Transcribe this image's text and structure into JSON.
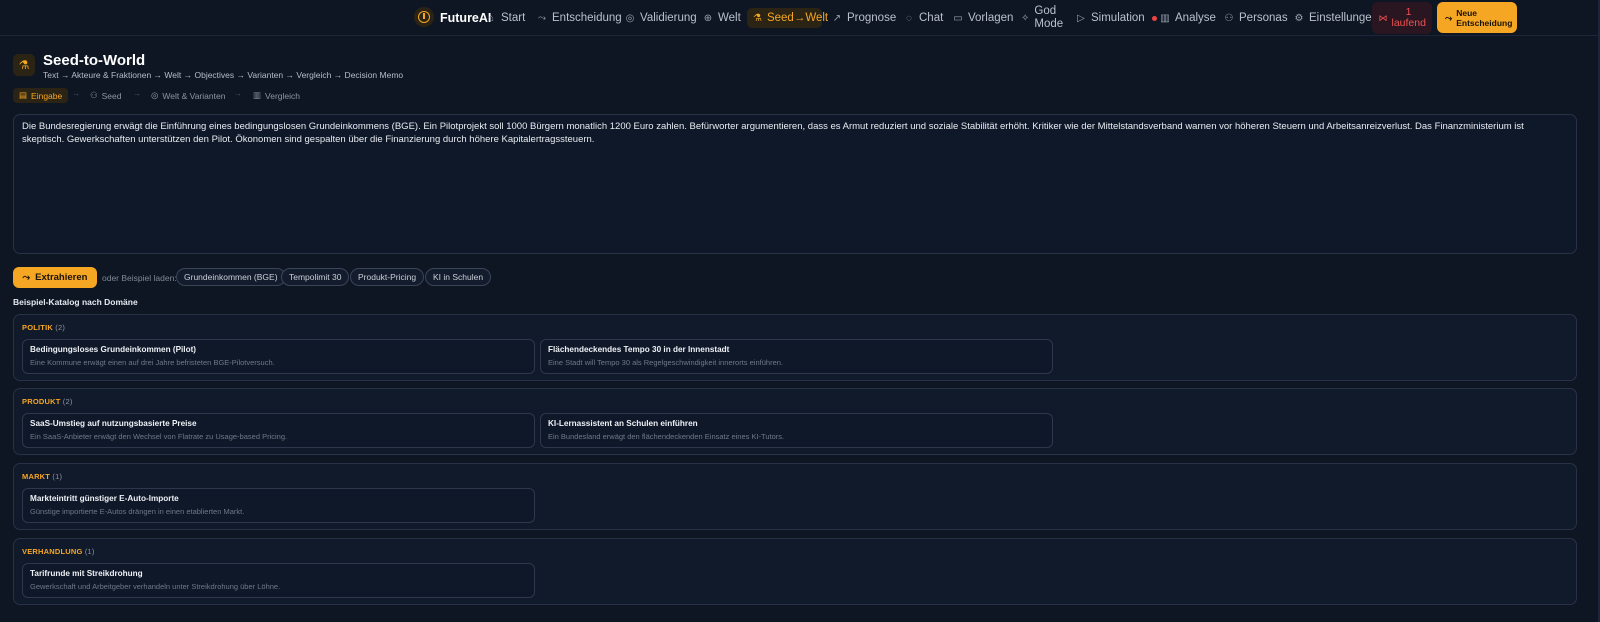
{
  "app": {
    "name": "FutureAI"
  },
  "nav": {
    "items": [
      {
        "label": "Start",
        "icon": "home-icon"
      },
      {
        "label": "Entscheidung",
        "icon": "route-icon"
      },
      {
        "label": "Validierung",
        "icon": "target-icon"
      },
      {
        "label": "Welt",
        "icon": "globe-icon"
      },
      {
        "label": "Seed→Welt",
        "icon": "flask-icon"
      },
      {
        "label": "Prognose",
        "icon": "trend-icon"
      },
      {
        "label": "Chat",
        "icon": "chat-icon"
      },
      {
        "label": "Vorlagen",
        "icon": "template-icon"
      },
      {
        "label": "God Mode",
        "icon": "sparkle-icon"
      },
      {
        "label": "Simulation",
        "icon": "play-icon"
      },
      {
        "label": "Analyse",
        "icon": "bar-chart-icon"
      },
      {
        "label": "Personas",
        "icon": "users-icon"
      },
      {
        "label": "Einstellungen",
        "icon": "gear-icon"
      }
    ],
    "running": "1 laufend",
    "new_decision": "Neue Entscheidung"
  },
  "page": {
    "title": "Seed-to-World",
    "subtitle": "Text → Akteure & Fraktionen → Welt → Objectives → Varianten → Vergleich → Decision Memo"
  },
  "steps": [
    "Eingabe",
    "Seed",
    "Welt & Varianten",
    "Vergleich"
  ],
  "input": {
    "value": "Die Bundesregierung erwägt die Einführung eines bedingungslosen Grundeinkommens (BGE). Ein Pilotprojekt soll 1000 Bürgern monatlich 1200 Euro zahlen. Befürworter argumentieren, dass es Armut reduziert und soziale Stabilität erhöht. Kritiker wie der Mittelstandsverband warnen vor höheren Steuern und Arbeitsanreizverlust. Das Finanzministerium ist skeptisch. Gewerkschaften unterstützen den Pilot. Ökonomen sind gespalten über die Finanzierung durch höhere Kapitalertragssteuern."
  },
  "actions": {
    "extract": "Extrahieren",
    "or_load": "oder Beispiel laden:",
    "examples": [
      "Grundeinkommen (BGE)",
      "Tempolimit 30",
      "Produkt-Pricing",
      "KI in Schulen"
    ]
  },
  "catalog": {
    "title": "Beispiel-Katalog nach Domäne",
    "sections": [
      {
        "name": "POLITIK",
        "count": "(2)",
        "cards": [
          {
            "title": "Bedingungsloses Grundeinkommen (Pilot)",
            "desc": "Eine Kommune erwägt einen auf drei Jahre befristeten BGE-Pilotversuch."
          },
          {
            "title": "Flächendeckendes Tempo 30 in der Innenstadt",
            "desc": "Eine Stadt will Tempo 30 als Regelgeschwindigkeit innerorts einführen."
          }
        ]
      },
      {
        "name": "PRODUKT",
        "count": "(2)",
        "cards": [
          {
            "title": "SaaS-Umstieg auf nutzungsbasierte Preise",
            "desc": "Ein SaaS-Anbieter erwägt den Wechsel von Flatrate zu Usage-based Pricing."
          },
          {
            "title": "KI-Lernassistent an Schulen einführen",
            "desc": "Ein Bundesland erwägt den flächendeckenden Einsatz eines KI-Tutors."
          }
        ]
      },
      {
        "name": "MARKT",
        "count": "(1)",
        "cards": [
          {
            "title": "Markteintritt günstiger E-Auto-Importe",
            "desc": "Günstige importierte E-Autos drängen in einen etablierten Markt."
          }
        ]
      },
      {
        "name": "VERHANDLUNG",
        "count": "(1)",
        "cards": [
          {
            "title": "Tarifrunde mit Streikdrohung",
            "desc": "Gewerkschaft und Arbeitgeber verhandeln unter Streikdrohung über Löhne."
          }
        ]
      }
    ]
  },
  "colors": {
    "accent": "#f5a623",
    "background": "#0e1624",
    "danger": "#ef4444"
  }
}
